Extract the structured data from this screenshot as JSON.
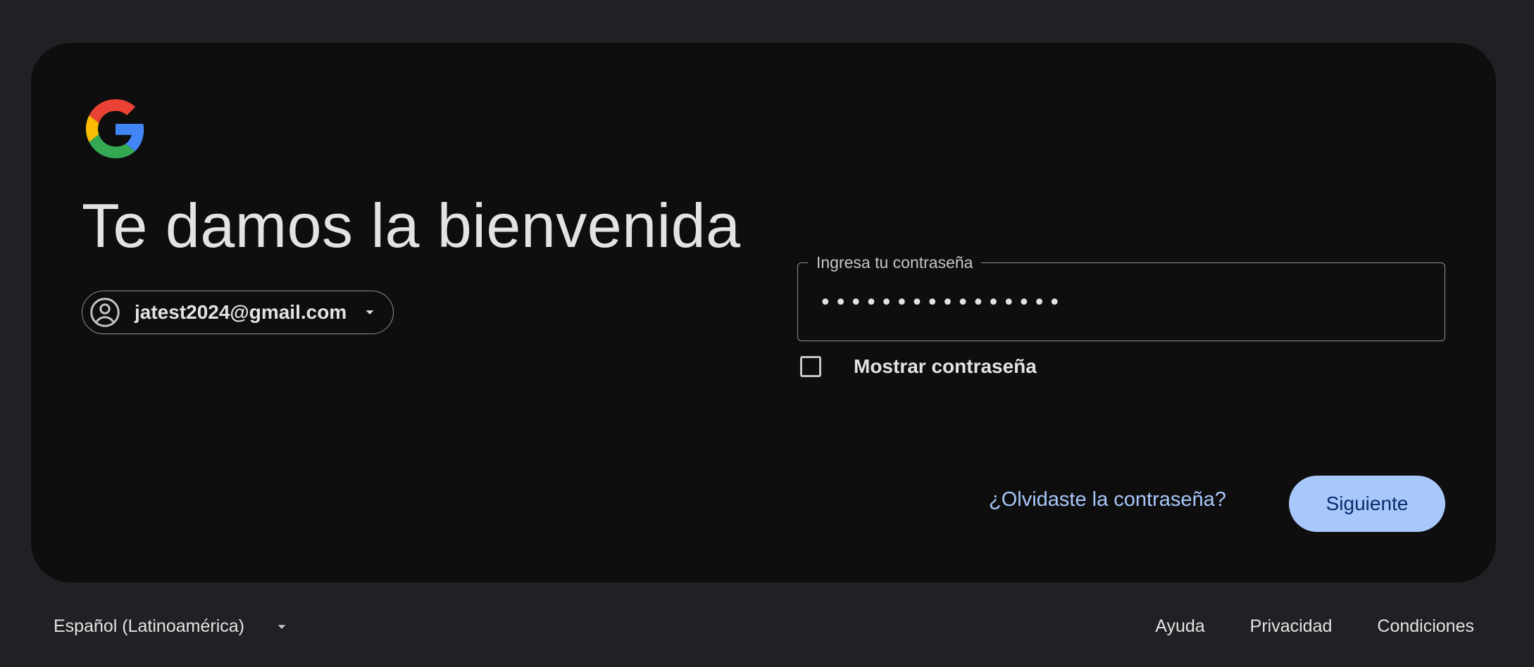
{
  "logo": {
    "icon": "google-g-logo-icon",
    "colors": {
      "red": "#EA4335",
      "yellow": "#FBBC05",
      "green": "#34A853",
      "blue": "#4285F4"
    }
  },
  "heading": {
    "title": "Te damos la bienvenida"
  },
  "account": {
    "email": "jatest2024@gmail.com",
    "avatar_icon": "account-circle-icon",
    "dropdown_icon": "chevron-down-icon"
  },
  "password": {
    "label": "Ingresa tu contraseña",
    "value": "••••••••••••••••"
  },
  "show_password": {
    "label": "Mostrar contraseña",
    "checked": false
  },
  "actions": {
    "forgot_label": "¿Olvidaste la contraseña?",
    "next_label": "Siguiente"
  },
  "footer": {
    "language": "Español (Latinoamérica)",
    "links": [
      "Ayuda",
      "Privacidad",
      "Condiciones"
    ]
  },
  "colors": {
    "page_bg": "#202124",
    "card_bg": "#0E0E0E",
    "accent": "#A8C7FA",
    "accent_text": "#062E6F"
  }
}
